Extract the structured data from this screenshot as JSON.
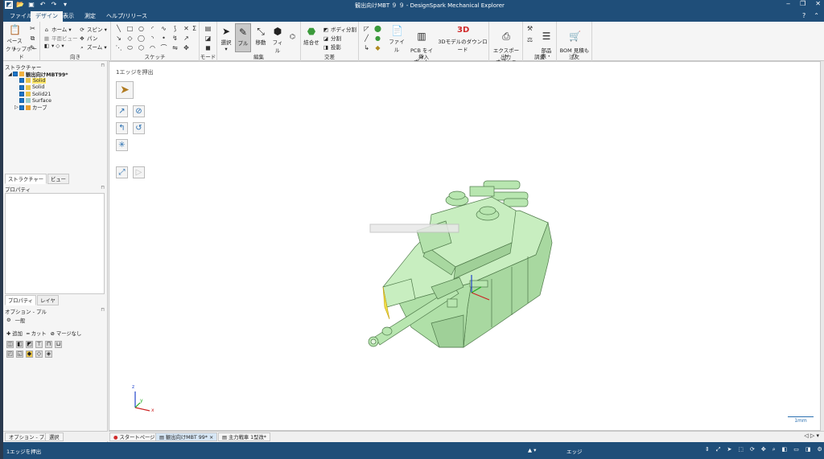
{
  "window": {
    "title": "観出向けMBT ９ ９ - DesignSpark Mechanical Explorer",
    "minimize": "‒",
    "restore": "❐",
    "close": "✕"
  },
  "menu": {
    "tabs": [
      "ファイル",
      "デザイン",
      "表示",
      "測定",
      "ヘルプ/リリース"
    ],
    "active": "デザイン"
  },
  "ribbon": {
    "clipboard": {
      "label": "クリップボード",
      "paste": "ペースト"
    },
    "orient": {
      "label": "向き",
      "home": "ホーム",
      "plane_view": "平面ビュー",
      "spin": "スピン",
      "pan": "パン",
      "zoom": "ズーム"
    },
    "sketch": {
      "label": "スケッチ"
    },
    "mode": {
      "label": "モード"
    },
    "edit": {
      "label": "編集",
      "select": "選択",
      "pull": "プル",
      "move": "移動",
      "fill": "フィル"
    },
    "intersect": {
      "label": "交差",
      "combine": "結合せ",
      "split_body": "ボディ分割",
      "split": "分割",
      "project": "投影"
    },
    "insert": {
      "label": "挿入",
      "file": "ファイル",
      "pcb": "PCB をイン\nポート",
      "download": "3Dモデルのダウンロード"
    },
    "output": {
      "label": "出力",
      "export": "エクスポート\nオプション・"
    },
    "investigate": {
      "label": "調査",
      "parts": "部品\n表・"
    },
    "order": {
      "label": "注文",
      "bom": "BOM 見積も\nり"
    }
  },
  "structure": {
    "title": "ストラクチャー",
    "root": "観出向けMBT99*",
    "items": [
      "Solid",
      "Solid",
      "Solid21",
      "Surface",
      "カーブ"
    ],
    "tabs": [
      "ストラクチャー",
      "ビュー"
    ]
  },
  "properties": {
    "title": "プロパティ",
    "tabs": [
      "プロパティ",
      "レイヤ"
    ]
  },
  "options": {
    "title": "オプション - プル",
    "general": "一般",
    "add": "追加",
    "cut": "カット",
    "no_merge": "マージなし"
  },
  "viewport": {
    "guide": "1エッジを押出",
    "scale": "1mm",
    "axes": {
      "x": "x",
      "y": "y",
      "z": "z"
    }
  },
  "left_bottom_tabs": [
    "オプション - プル",
    "選択"
  ],
  "doc_tabs": [
    "スタートページ",
    "観出向けMBT 99*",
    "主力戦車 1型改*"
  ],
  "status": {
    "left": "1エッジを押出",
    "mode": "エッジ"
  },
  "colors": {
    "titlebar": "#1f4e79",
    "model_fill": "#b8e6b0",
    "model_edge": "#4f7a4a",
    "highlight": "#f2e24a"
  }
}
